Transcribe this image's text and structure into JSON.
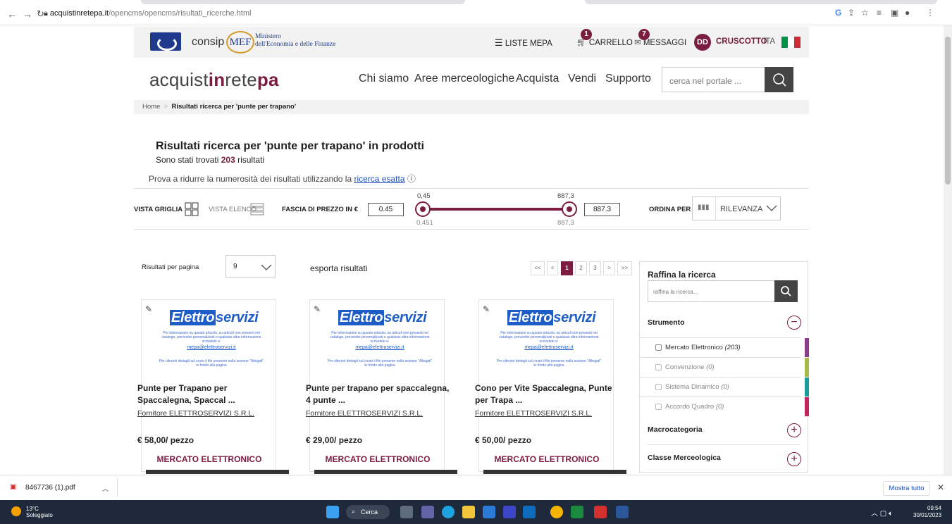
{
  "browser": {
    "url_host": "acquistinretepa.it",
    "url_path": "/opencms/opencms/risultati_ricerche.html"
  },
  "topbar": {
    "consip": "consip",
    "mef_mark": "MEF",
    "mef_line1": "Ministero",
    "mef_line2": "dell'Economia e delle Finanze",
    "liste_mepa": "LISTE MEPA",
    "carrello": "CARRELLO",
    "carrello_count": "1",
    "messaggi": "MESSAGGI",
    "messaggi_count": "7",
    "avatar": "DD",
    "cruscotto": "CRUSCOTTO",
    "lang": "ITA",
    "flag_colors": [
      "#009246",
      "#ffffff",
      "#ce2b37"
    ]
  },
  "brand": {
    "pre": "acquist",
    "mid": "in",
    "post": "rete",
    "end": "pa"
  },
  "menu": [
    "Chi siamo",
    "Aree merceologiche",
    "Acquista",
    "Vendi",
    "Supporto"
  ],
  "search": {
    "placeholder": "cerca nel portale ..."
  },
  "breadcrumb": {
    "home": "Home",
    "sep": ">",
    "current": "Risultati ricerca per 'punte per trapano'"
  },
  "results": {
    "heading": "Risultati ricerca per 'punte per trapano' in prodotti",
    "count_pre": "Sono stati trovati ",
    "count": "203",
    "count_post": " risultati",
    "hint_pre": "Prova a ridurre la numerosità dei risultati utilizzando la ",
    "hint_link": "ricerca esatta",
    "hint_icon": "ⓘ"
  },
  "filters": {
    "vista_griglia": "VISTA GRIGLIA",
    "vista_elenco": "VISTA ELENCO",
    "fascia": "FASCIA DI PREZZO IN €",
    "min_value": "0.45",
    "max_value": "887.3",
    "min_top": "0,45",
    "max_top": "887,3",
    "min_bottom": "0,451",
    "max_bottom": "887,3",
    "ordina_per": "ORDINA PER",
    "sort_value": "RILEVANZA"
  },
  "listing": {
    "per_page_label": "Risultati per pagina",
    "per_page_value": "9",
    "export": "esporta risultati",
    "pages": [
      "<<",
      "<",
      "1",
      "2",
      "3",
      ">",
      ">>"
    ]
  },
  "card_common": {
    "logo_a": "Elettro",
    "logo_b": "servizi",
    "fine1": "Per informazioni su questo articolo, su articoli non presenti nel catalogo, preventivi personalizzati o qualsiasi altra informazione scrivetele a:",
    "mail": "mepa@elettroservizi.it",
    "fine2": "Per ulteriori dettagli sul costo il file presente nella sezione \"Allegati\" in fondo alla pagina"
  },
  "cards": [
    {
      "title": "Punte per Trapano per Spaccalegna, Spaccal ...",
      "vendor": "Fornitore ELETTROSERVIZI S.R.L.",
      "price": "€ 58,00/ pezzo",
      "tag": "MERCATO ELETTRONICO"
    },
    {
      "title": "Punte per trapano per spaccalegna, 4 punte ...",
      "vendor": "Fornitore ELETTROSERVIZI S.R.L.",
      "price": "€ 29,00/ pezzo",
      "tag": "MERCATO ELETTRONICO"
    },
    {
      "title": "Cono per Vite Spaccalegna, Punte per Trapa ...",
      "vendor": "Fornitore ELETTROSERVIZI S.R.L.",
      "price": "€ 50,00/ pezzo",
      "tag": "MERCATO ELETTRONICO"
    }
  ],
  "panel": {
    "title": "Raffina la ricerca",
    "placeholder": "raffina la ricerca...",
    "strumento": "Strumento",
    "options": [
      {
        "label": "Mercato Elettronico",
        "count": "(203)",
        "color": "#8e3b8b"
      },
      {
        "label": "Convenzione",
        "count": "(0)",
        "color": "#a9b84a"
      },
      {
        "label": "Sistema Dinamico",
        "count": "(0)",
        "color": "#1a9c9a"
      },
      {
        "label": "Accordo Quadro",
        "count": "(0)",
        "color": "#c2245e"
      }
    ],
    "macro": "Macrocategoria",
    "classe": "Classe Merceologica"
  },
  "downloads": {
    "file": "8467736 (1).pdf",
    "show_all": "Mostra tutto"
  },
  "taskbar": {
    "temp": "13°C",
    "weather": "Soleggiato",
    "search": "Cerca",
    "time": "09:54",
    "date": "30/01/2023"
  }
}
